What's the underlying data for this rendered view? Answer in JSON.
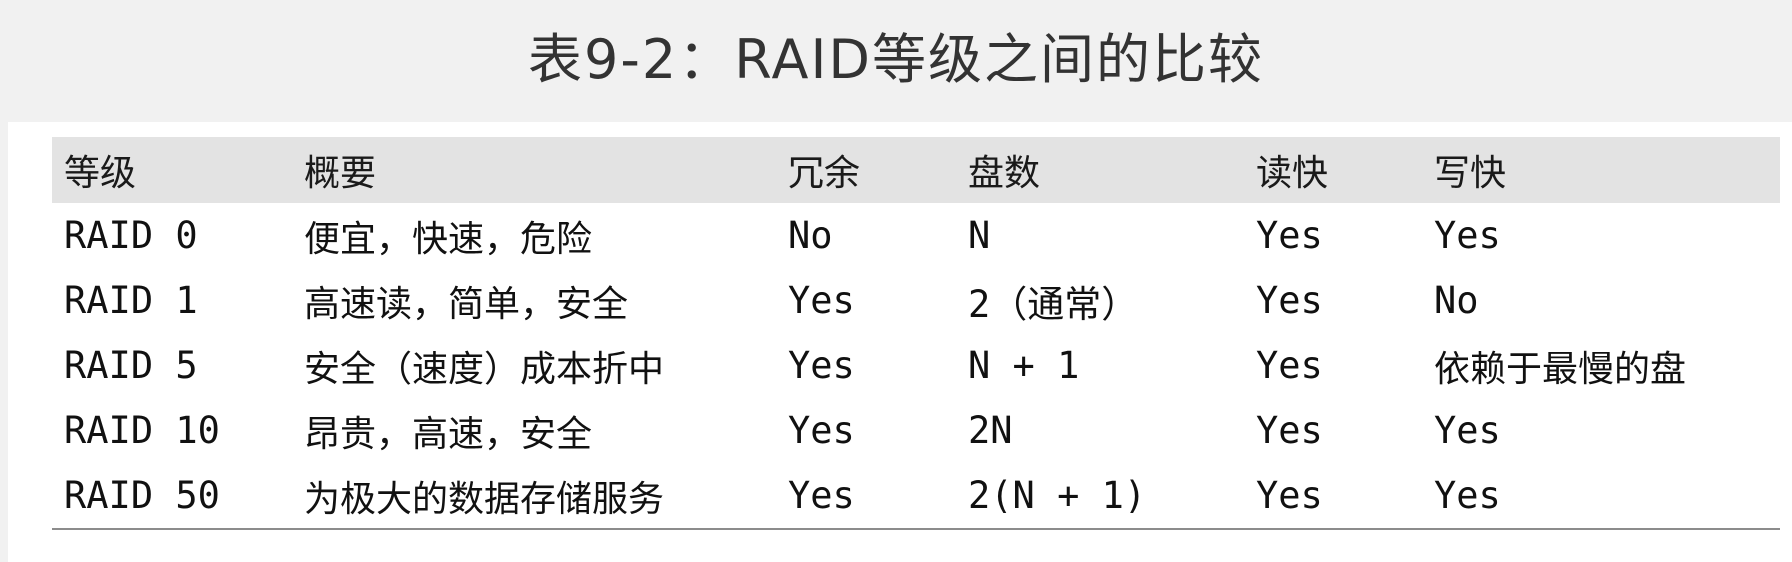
{
  "caption": "表9-2：RAID等级之间的比较",
  "headers": [
    "等级",
    "概要",
    "冗余",
    "盘数",
    "读快",
    "写快"
  ],
  "rows": [
    [
      "RAID 0",
      "便宜，快速，危险",
      "No",
      "N",
      "Yes",
      "Yes"
    ],
    [
      "RAID 1",
      "高速读，简单，安全",
      "Yes",
      "2（通常）",
      "Yes",
      "No"
    ],
    [
      "RAID 5",
      "安全（速度）成本折中",
      "Yes",
      "N + 1",
      "Yes",
      "依赖于最慢的盘"
    ],
    [
      "RAID 10",
      "昂贵，高速，安全",
      "Yes",
      "2N",
      "Yes",
      "Yes"
    ],
    [
      "RAID 50",
      "为极大的数据存储服务",
      "Yes",
      "2(N + 1)",
      "Yes",
      "Yes"
    ]
  ]
}
